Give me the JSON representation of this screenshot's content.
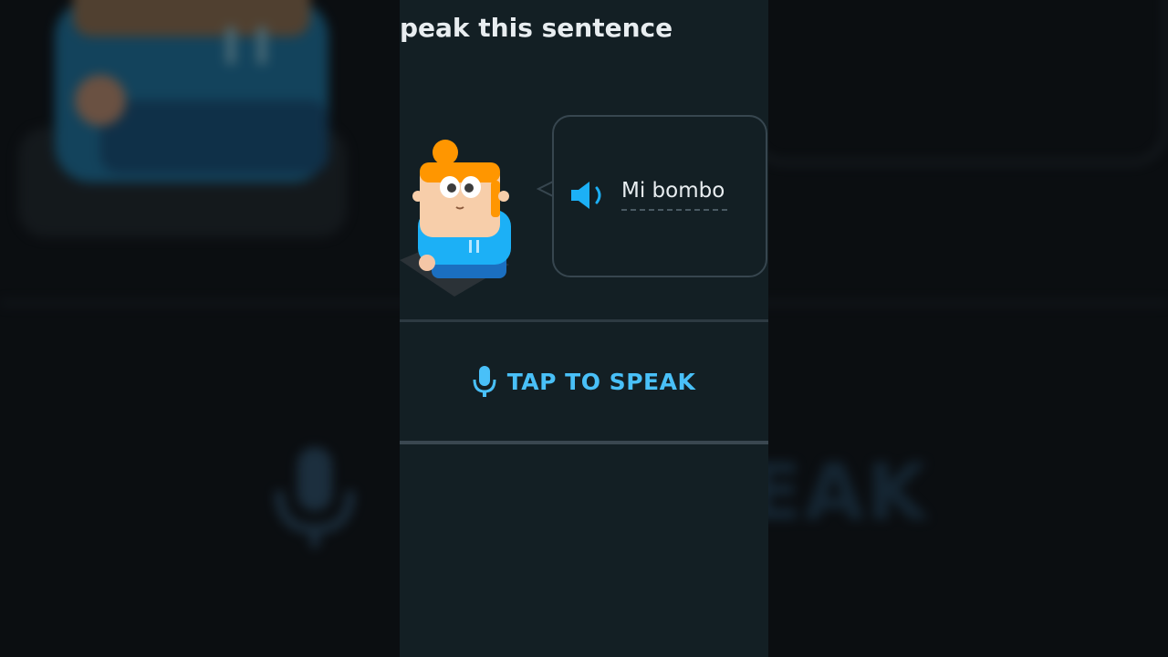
{
  "prompt": {
    "text": "peak this sentence"
  },
  "bubble": {
    "phrase": "Mi bombo"
  },
  "speak_button": {
    "label": "TAP TO SPEAK"
  },
  "background": {
    "partial_text": "EAK"
  },
  "icons": {
    "character": "character-avatar",
    "speaker": "speaker-icon",
    "mic": "microphone-icon"
  },
  "colors": {
    "panel": "#131f24",
    "accent": "#49c0f8",
    "text": "#e8edf0",
    "border": "#37464f"
  }
}
